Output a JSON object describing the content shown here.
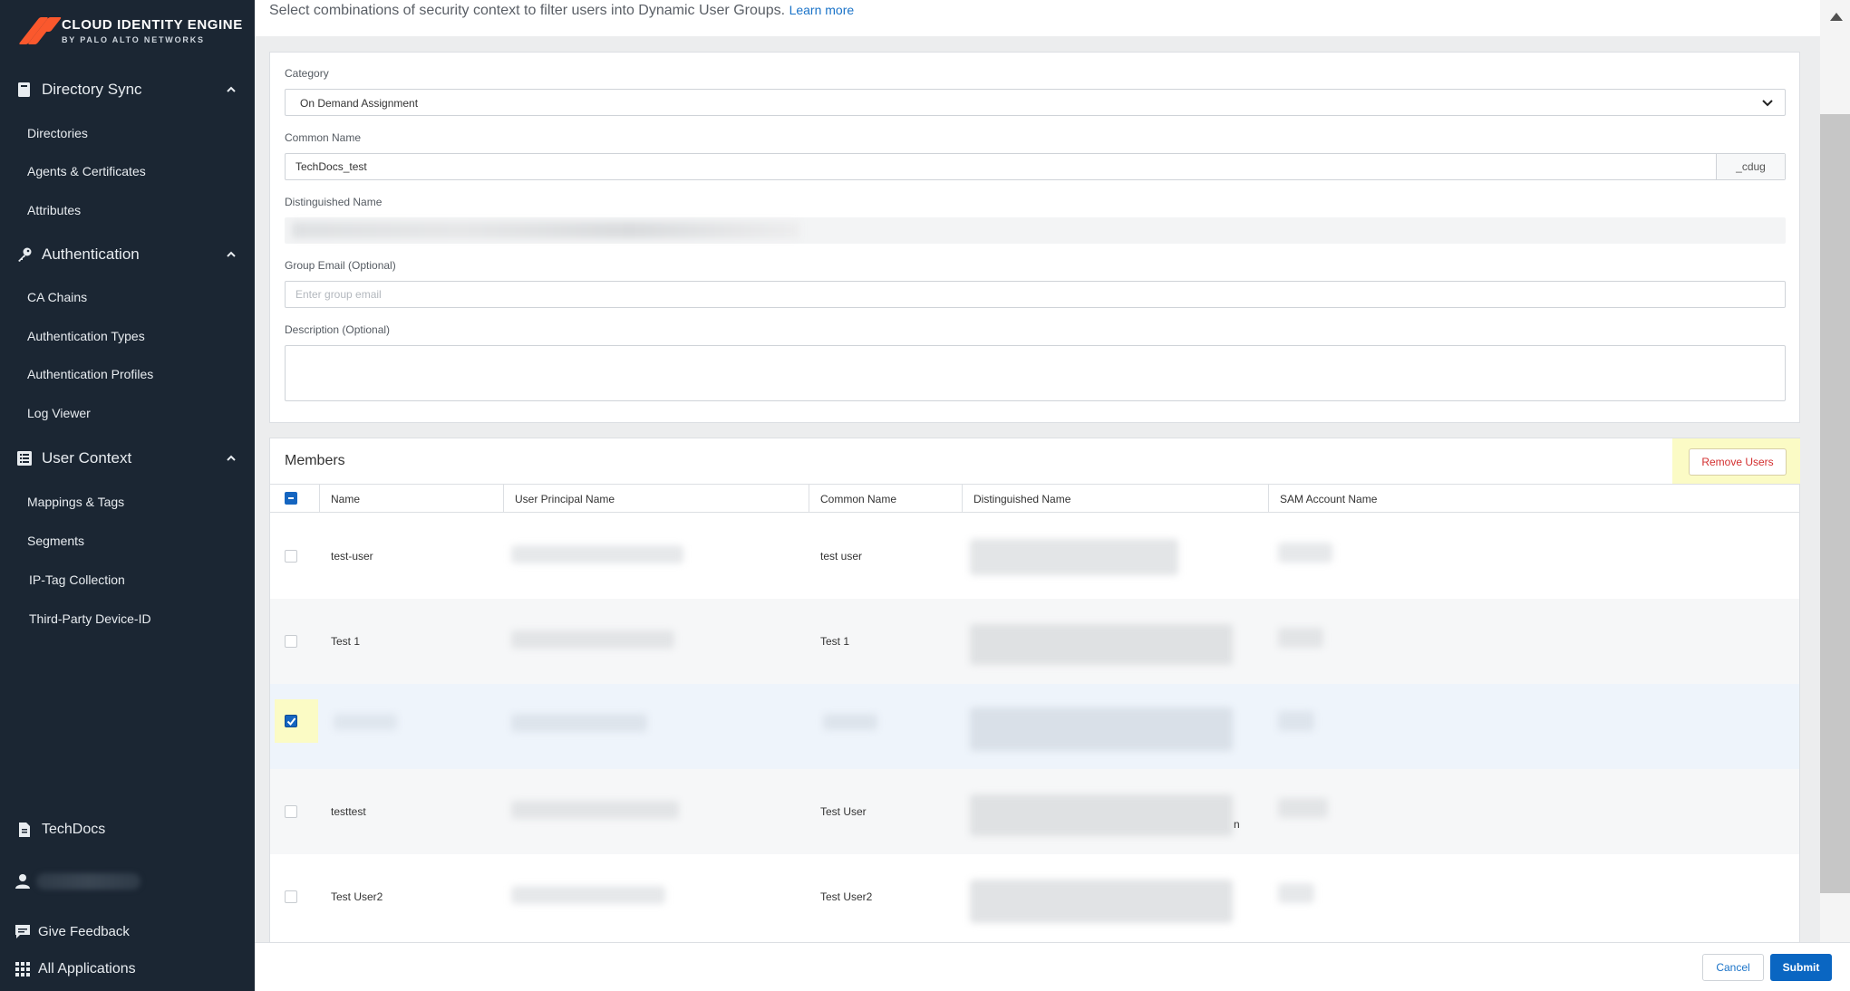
{
  "sidebar": {
    "logo_title": "CLOUD IDENTITY ENGINE",
    "logo_sub": "BY PALO ALTO NETWORKS",
    "sections": [
      {
        "label": "Directory Sync",
        "items": [
          "Directories",
          "Agents & Certificates",
          "Attributes"
        ]
      },
      {
        "label": "Authentication",
        "items": [
          "CA Chains",
          "Authentication Types",
          "Authentication Profiles",
          "Log Viewer"
        ]
      },
      {
        "label": "User Context",
        "items": [
          "Mappings & Tags",
          "Segments",
          "IP-Tag Collection",
          "Third-Party Device-ID"
        ]
      }
    ],
    "bottom": {
      "techdocs": "TechDocs",
      "feedback": "Give Feedback",
      "all_apps": "All Applications"
    }
  },
  "header": {
    "description": "Select combinations of security context to filter users into Dynamic User Groups.",
    "learn_more": "Learn more"
  },
  "form": {
    "category_label": "Category",
    "category_value": "On Demand Assignment",
    "common_name_label": "Common Name",
    "common_name_value": "TechDocs_test",
    "common_name_suffix": "_cdug",
    "dn_label": "Distinguished Name",
    "email_label": "Group Email (Optional)",
    "email_placeholder": "Enter group email",
    "description_label": "Description (Optional)"
  },
  "members": {
    "title": "Members",
    "remove_label": "Remove Users",
    "columns": [
      "Name",
      "User Principal Name",
      "Common Name",
      "Distinguished Name",
      "SAM Account Name"
    ],
    "rows": [
      {
        "name": "test-user",
        "common_name": "test user",
        "checked": false
      },
      {
        "name": "Test 1",
        "common_name": "Test 1",
        "checked": false
      },
      {
        "name": "",
        "common_name": "",
        "checked": true
      },
      {
        "name": "testtest",
        "common_name": "Test User",
        "checked": false
      },
      {
        "name": "Test User2",
        "common_name": "Test User2",
        "checked": false
      }
    ],
    "stray_char": "n"
  },
  "footer": {
    "cancel": "Cancel",
    "submit": "Submit"
  },
  "colors": {
    "sidebar_bg": "#1b2633",
    "accent": "#0a66c2",
    "logo": "#fa582d",
    "danger": "#d32f2f",
    "highlight": "#fbfbc5"
  }
}
